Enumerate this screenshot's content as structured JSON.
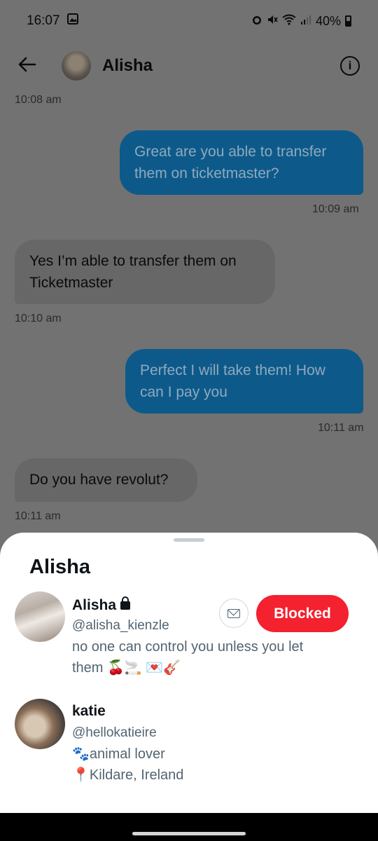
{
  "status_bar": {
    "time": "16:07",
    "battery": "40%",
    "icons": [
      "image-icon",
      "alarm-icon",
      "mute-icon",
      "wifi-icon",
      "signal-icon",
      "battery-icon"
    ]
  },
  "header": {
    "name": "Alisha",
    "back_icon": "arrow-left-icon",
    "info_icon": "info-icon"
  },
  "messages": [
    {
      "type": "timestamp",
      "text": "10:08 am"
    },
    {
      "type": "outgoing",
      "text": "Great are you able to transfer them on ticketmaster?",
      "time": "10:09 am"
    },
    {
      "type": "incoming",
      "text": "Yes I’m able to transfer them on Ticketmaster",
      "time": "10:10 am"
    },
    {
      "type": "outgoing",
      "text": "Perfect I will take them! How can I pay you",
      "time": "10:11 am"
    },
    {
      "type": "incoming",
      "text": "Do you have revolut?",
      "time": "10:11 am"
    }
  ],
  "sheet": {
    "title": "Alisha",
    "users": [
      {
        "name": "Alisha",
        "handle": "@alisha_kienzle",
        "bio_line1": "no one can control you unless you let",
        "bio_line2": "them 🍒🚬 💌🎸",
        "button_label": "Blocked",
        "protected": true
      },
      {
        "name": "katie",
        "handle": "@hellokatieire",
        "bio_line1": "🐾animal lover",
        "bio_line2": "📍Kildare, Ireland"
      }
    ]
  },
  "colors": {
    "overlay_background": "#727272",
    "outgoing_bubble": "#0d5a8a",
    "incoming_bubble": "#676767",
    "blocked_button": "#f4212e"
  }
}
